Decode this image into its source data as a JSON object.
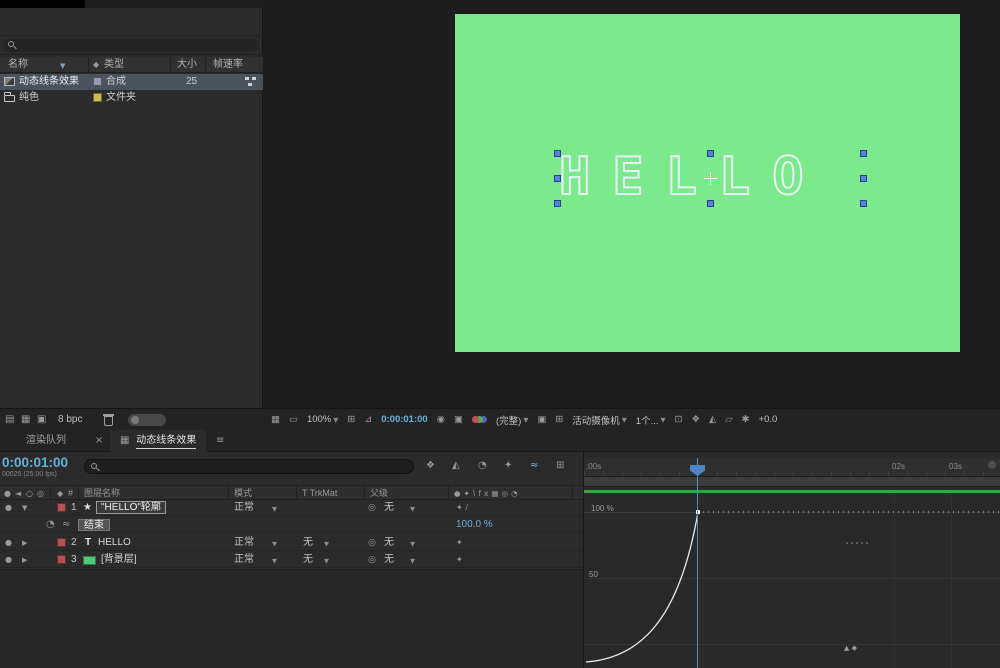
{
  "colors": {
    "comp_background_green": "#7de98d",
    "time_display_cyan": "#66b2da",
    "property_value_blue": "#6fb1e0",
    "selection_handle_blue": "#5b80d9",
    "timeline_layer_bar_green": "#3fa23d"
  },
  "project": {
    "columns": {
      "name": "名称",
      "type": "类型",
      "size": "大小",
      "framerate": "帧速率"
    },
    "rows": [
      {
        "name": "动态线条效果",
        "type": "合成",
        "size": "25"
      },
      {
        "name": "纯色",
        "type": "文件夹",
        "size": ""
      }
    ],
    "footer": {
      "bpc": "8 bpc"
    }
  },
  "viewer": {
    "comp_text": "HELLO",
    "toolbar": {
      "zoom": "100%",
      "time": "0:00:01:00",
      "resolution": "(完整)",
      "camera": "活动摄像机",
      "view_count": "1个...",
      "exposure": "+0.0"
    }
  },
  "timeline": {
    "tabs": [
      {
        "label": "渲染队列"
      },
      {
        "label": "动态线条效果"
      }
    ],
    "time": "0:00:01:00",
    "frame_info": "00025 (25.00 fps)",
    "columns": {
      "layer_name": "图层名称",
      "mode": "模式",
      "trkmat": "T TrkMat",
      "parent": "父级"
    },
    "layers": [
      {
        "index": "1",
        "name": "\"HELLO\"轮廓",
        "mode": "正常",
        "trkmat": "",
        "parent": "无"
      },
      {
        "index": "2",
        "name": "HELLO",
        "mode": "正常",
        "trkmat": "无",
        "parent": "无"
      },
      {
        "index": "3",
        "name": "[背景层]",
        "mode": "正常",
        "trkmat": "无",
        "parent": "无"
      }
    ],
    "property": {
      "name": "结束",
      "value": "100.0 %"
    },
    "ruler": {
      "t0": ":00s",
      "t2": "02s",
      "t3": "03s"
    },
    "graph": {
      "label_100": "100 %",
      "label_50": "50",
      "curve": {
        "property": "结束",
        "start_value": 0,
        "end_value": 100,
        "end_time": "0:00:01:00"
      }
    }
  }
}
